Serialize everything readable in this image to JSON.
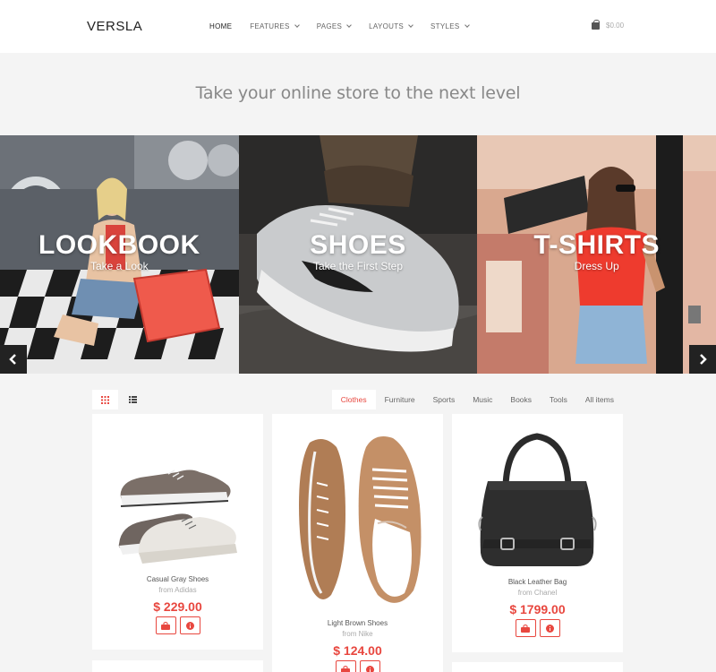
{
  "header": {
    "logo": "VERSLA",
    "nav": [
      {
        "label": "HOME",
        "has_dropdown": false
      },
      {
        "label": "FEATURES",
        "has_dropdown": true
      },
      {
        "label": "PAGES",
        "has_dropdown": true
      },
      {
        "label": "LAYOUTS",
        "has_dropdown": true
      },
      {
        "label": "STYLES",
        "has_dropdown": true
      }
    ],
    "cart_total": "$0.00"
  },
  "tagline": "Take your online store to the next level",
  "banner": {
    "panels": [
      {
        "title": "LOOKBOOK",
        "subtitle": "Take a Look"
      },
      {
        "title": "SHOES",
        "subtitle": "Take the First Step"
      },
      {
        "title": "T-SHIRTS",
        "subtitle": "Dress Up"
      }
    ]
  },
  "toolbar": {
    "view_modes": [
      "grid-icon",
      "list-icon"
    ],
    "filters": [
      {
        "label": "Clothes",
        "active": true
      },
      {
        "label": "Furniture",
        "active": false
      },
      {
        "label": "Sports",
        "active": false
      },
      {
        "label": "Music",
        "active": false
      },
      {
        "label": "Books",
        "active": false
      },
      {
        "label": "Tools",
        "active": false
      },
      {
        "label": "All items",
        "active": false
      }
    ]
  },
  "products": [
    {
      "name": "Casual Gray Shoes",
      "brand": "from Adidas",
      "price": "$ 229.00"
    },
    {
      "name": "Light Brown Shoes",
      "brand": "from Nike",
      "price": "$ 124.00"
    },
    {
      "name": "Black Leather Bag",
      "brand": "from Chanel",
      "price": "$ 1799.00"
    }
  ],
  "colors": {
    "accent": "#e8473f",
    "page_bg": "#f4f4f4",
    "card_bg": "#ffffff"
  }
}
